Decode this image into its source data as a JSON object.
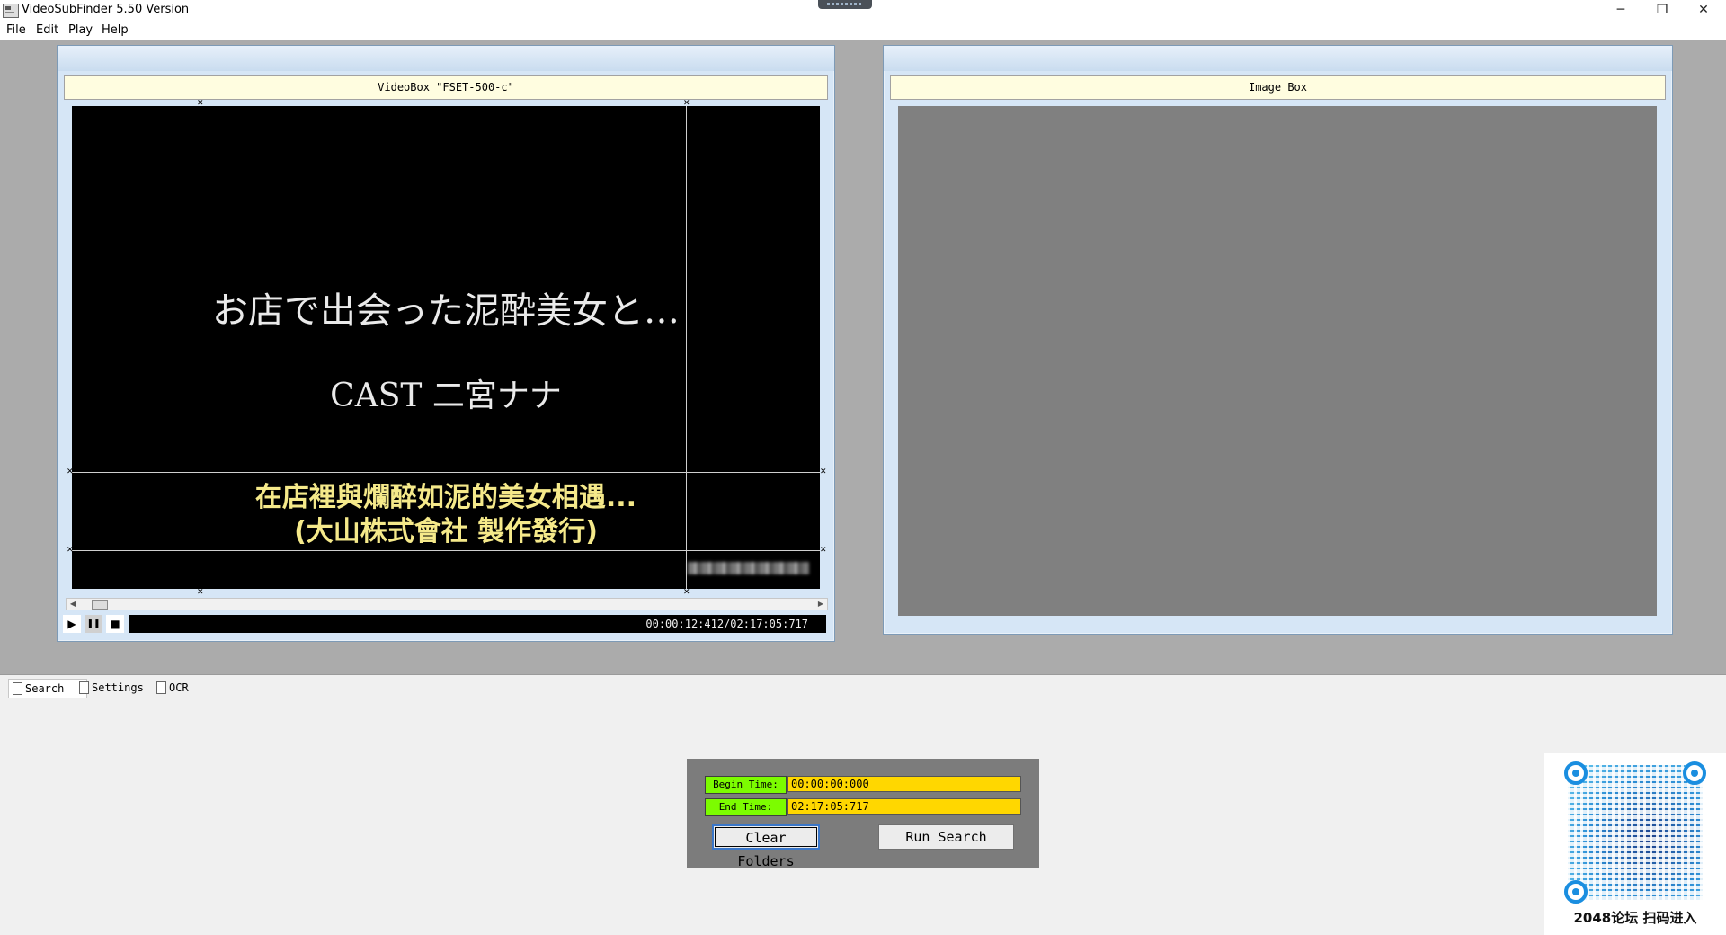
{
  "window": {
    "title": "VideoSubFinder 5.50 Version",
    "minimize": "─",
    "maximize": "❐",
    "close": "✕"
  },
  "menu": [
    "File",
    "Edit",
    "Play",
    "Help"
  ],
  "video_panel": {
    "caption": "VideoBox \"FSET-500-c\"",
    "frame_text_line1": "お店で出会った泥酔美女と…",
    "frame_text_line2": "CAST 二宮ナナ",
    "subtitle_line1": "在店裡與爛醉如泥的美女相遇...",
    "subtitle_line2": "(大山株式會社 製作發行)",
    "seek_left": "◀",
    "seek_right": "▶",
    "play": "▶",
    "pause": "❚❚",
    "stop": "■",
    "time": "00:00:12:412/02:17:05:717"
  },
  "image_panel": {
    "caption": "Image Box"
  },
  "tabs": [
    "Search",
    "Settings",
    "OCR"
  ],
  "search": {
    "begin_label": "Begin Time:",
    "begin_value": "00:00:00:000",
    "end_label": "End Time:",
    "end_value": "02:17:05:717",
    "clear_button": "Clear Folders",
    "run_button": "Run Search"
  },
  "qr": {
    "caption": "2048论坛 扫码进入"
  },
  "colors": {
    "label_green": "#7cfc00",
    "input_yellow": "#ffd700",
    "qr_blue": "#1a8ee0"
  }
}
